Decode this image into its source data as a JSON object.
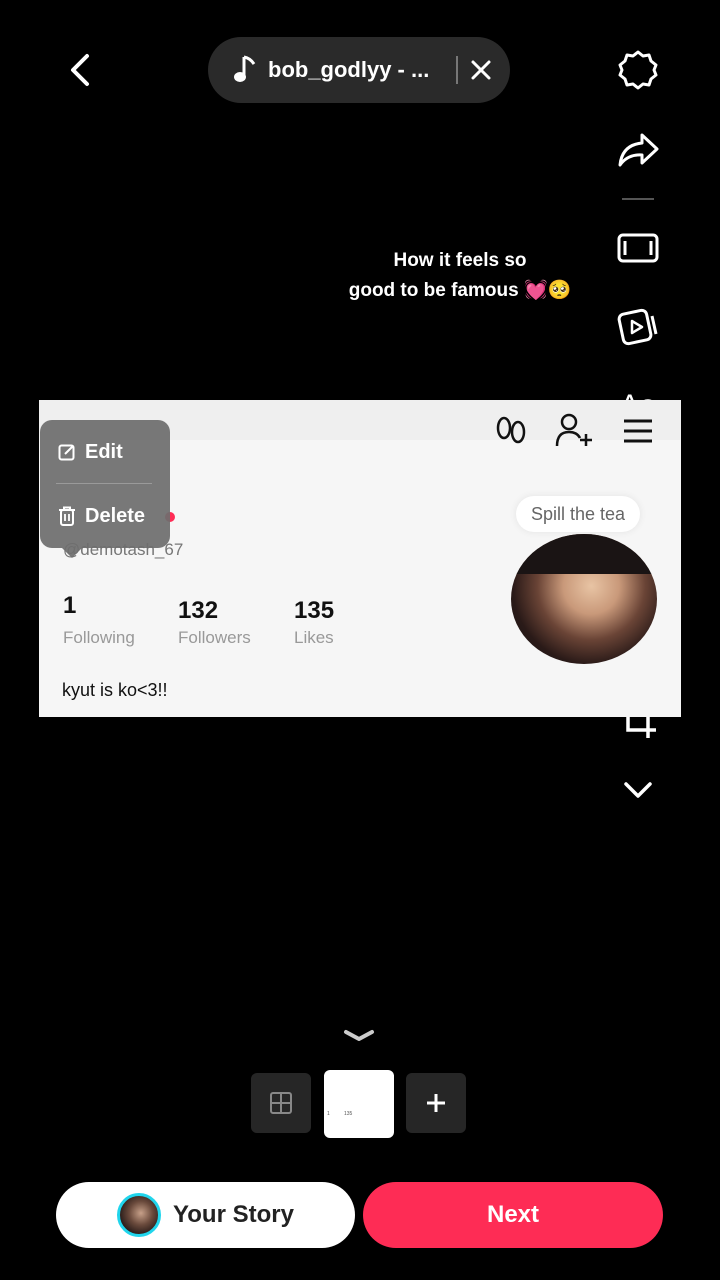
{
  "top_bar": {
    "back_icon": "chevron-left-icon",
    "sound_label": "bob_godlyy - ...",
    "sound_icon": "music-note-icon",
    "close_icon": "close-icon"
  },
  "toolbar": {
    "icons": [
      "settings-gear-icon",
      "share-arrow-icon",
      "aspect-ratio-icon",
      "video-play-icon",
      "text-icon",
      "sticker-icon",
      "sparkle-effects-icon",
      "filters-icon",
      "crop-icon",
      "chevron-down-icon"
    ],
    "text_label": "Aa"
  },
  "caption": {
    "line1": "How it feels so",
    "line2": "good to be famous 💓🥺"
  },
  "profile_card": {
    "handle": "@demotash_67",
    "following_count": "1",
    "following_label": "Following",
    "followers_count": "132",
    "followers_label": "Followers",
    "likes_count": "135",
    "likes_label": "Likes",
    "bio": "kyut is ko<3!!",
    "spill_label": "Spill the tea"
  },
  "popup": {
    "edit_label": "Edit",
    "delete_label": "Delete"
  },
  "bottom": {
    "your_story_label": "Your Story",
    "next_label": "Next",
    "mini_a": "1",
    "mini_b": "135"
  },
  "colors": {
    "accent": "#fe2c55",
    "story_ring": "#20d5ec",
    "background": "#000000"
  }
}
